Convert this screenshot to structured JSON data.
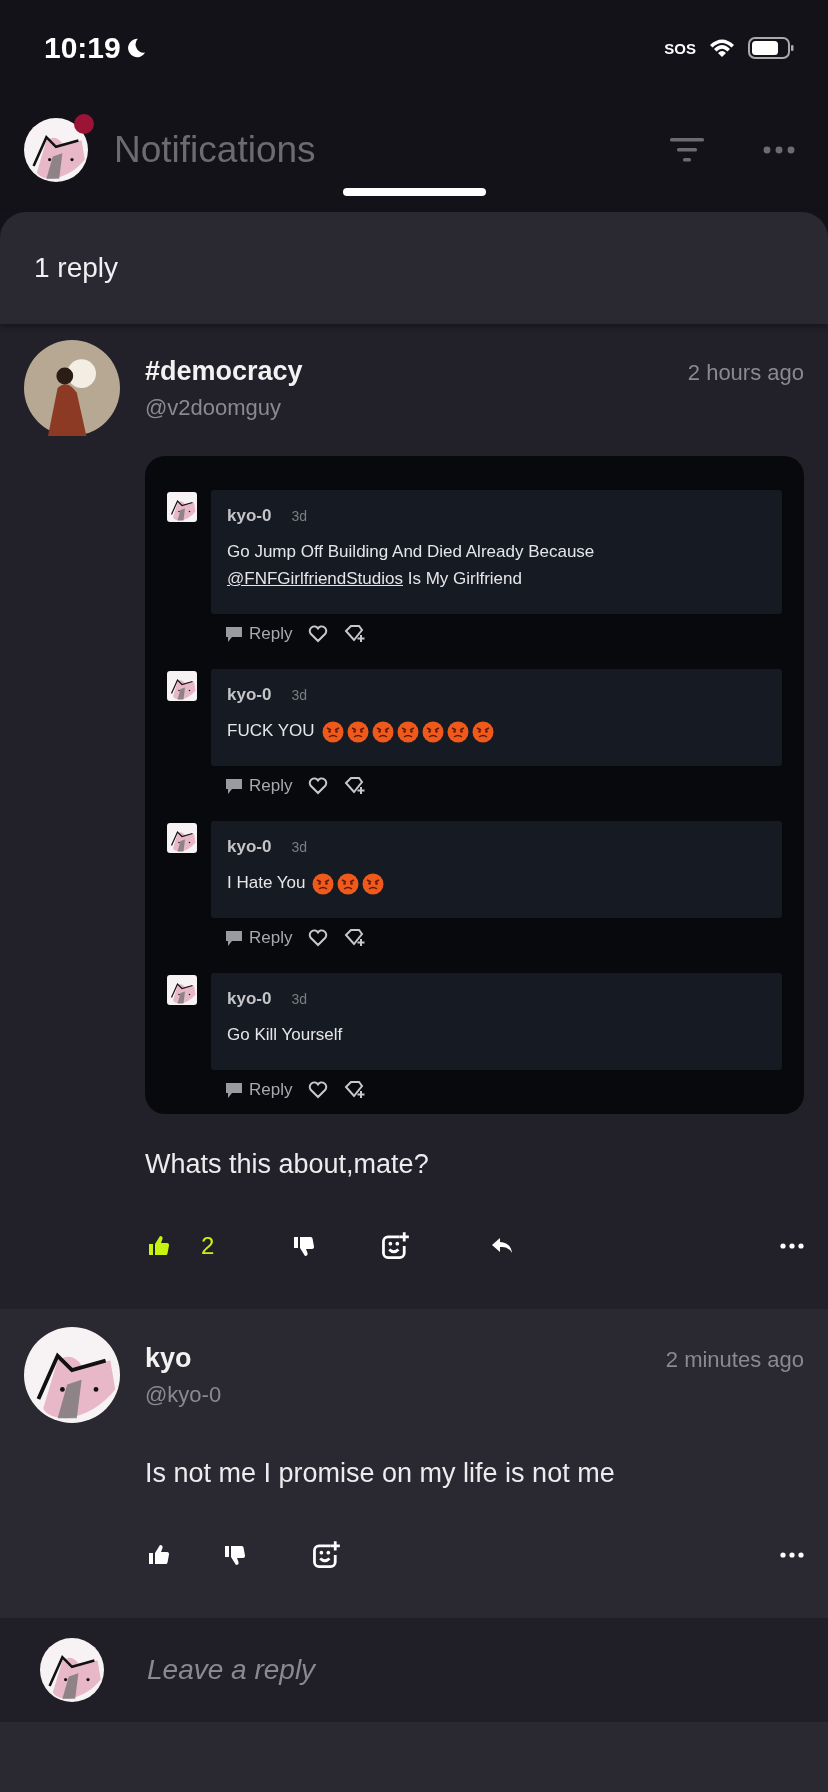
{
  "status_bar": {
    "time": "10:19",
    "sos": "SOS"
  },
  "header": {
    "title": "Notifications",
    "unread": true
  },
  "sheet": {
    "title": "1 reply"
  },
  "post": {
    "name": "#democracy",
    "handle": "@v2doomguy",
    "time": "2 hours ago",
    "embedded_comments": [
      {
        "user": "kyo-0",
        "age": "3d",
        "text": "Go Jump Off Building And Died Already Because",
        "mention": "@FNFGirlfriendStudios",
        "text_end": "Is My Girlfriend",
        "reply_label": "Reply"
      },
      {
        "user": "kyo-0",
        "age": "3d",
        "text": "FUCK YOU",
        "emojis": [
          {
            "kind": "angry"
          },
          {
            "kind": "angry"
          },
          {
            "kind": "angry"
          },
          {
            "kind": "angry"
          },
          {
            "kind": "angry"
          },
          {
            "kind": "angry"
          },
          {
            "kind": "angry"
          }
        ],
        "reply_label": "Reply"
      },
      {
        "user": "kyo-0",
        "age": "3d",
        "text": "I Hate You",
        "emojis": [
          {
            "kind": "angry"
          },
          {
            "kind": "angry"
          },
          {
            "kind": "angry"
          }
        ],
        "reply_label": "Reply"
      },
      {
        "user": "kyo-0",
        "age": "3d",
        "text": "Go Kill Yourself",
        "reply_label": "Reply"
      }
    ],
    "text": "Whats this about,mate?",
    "likes": "2",
    "liked": true,
    "has_reply_action": true
  },
  "reply": {
    "name": "kyo",
    "handle": "@kyo-0",
    "time": "2 minutes ago",
    "text": "Is not me I promise on my life is not me",
    "liked": false,
    "has_reply_action": false
  },
  "composer": {
    "placeholder": "Leave a reply"
  }
}
